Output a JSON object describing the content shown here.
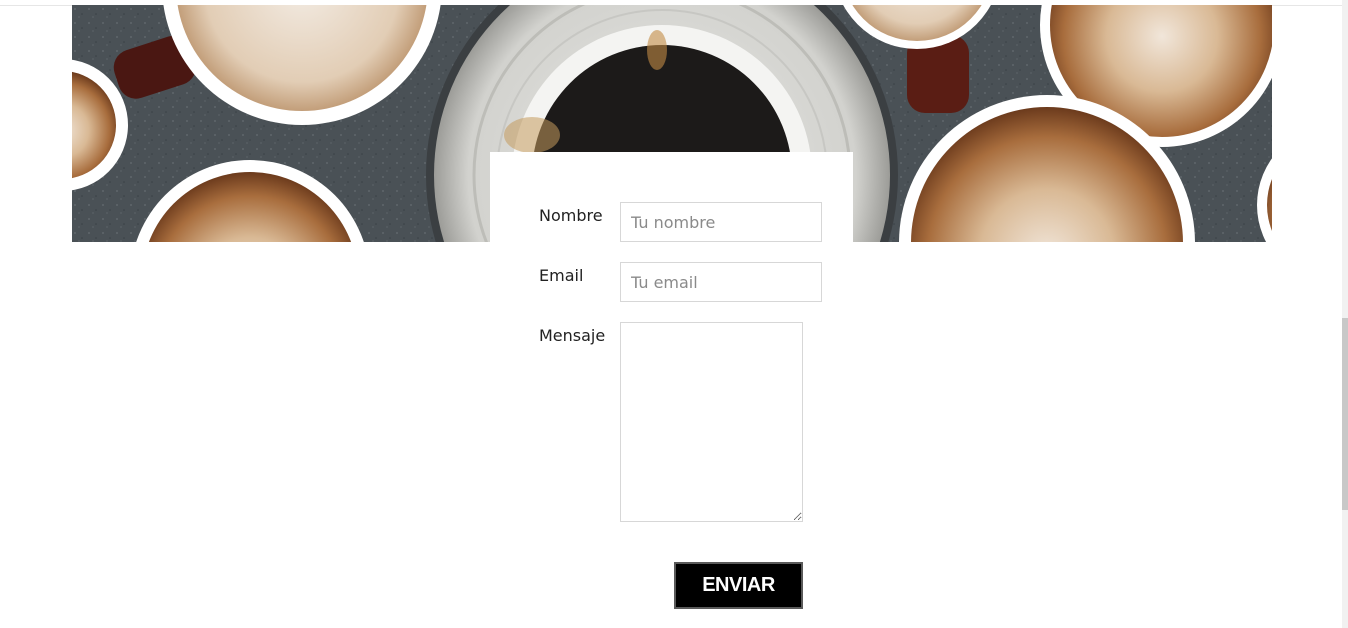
{
  "contact_form": {
    "name_label": "Nombre",
    "name_placeholder": "Tu nombre",
    "email_label": "Email",
    "email_placeholder": "Tu email",
    "message_label": "Mensaje",
    "message_value": "",
    "submit_label": "ENVIAR"
  },
  "colors": {
    "button_background": "#000000",
    "button_text": "#ffffff",
    "input_border": "#d7d7d7",
    "hero_background": "#4b5257"
  }
}
